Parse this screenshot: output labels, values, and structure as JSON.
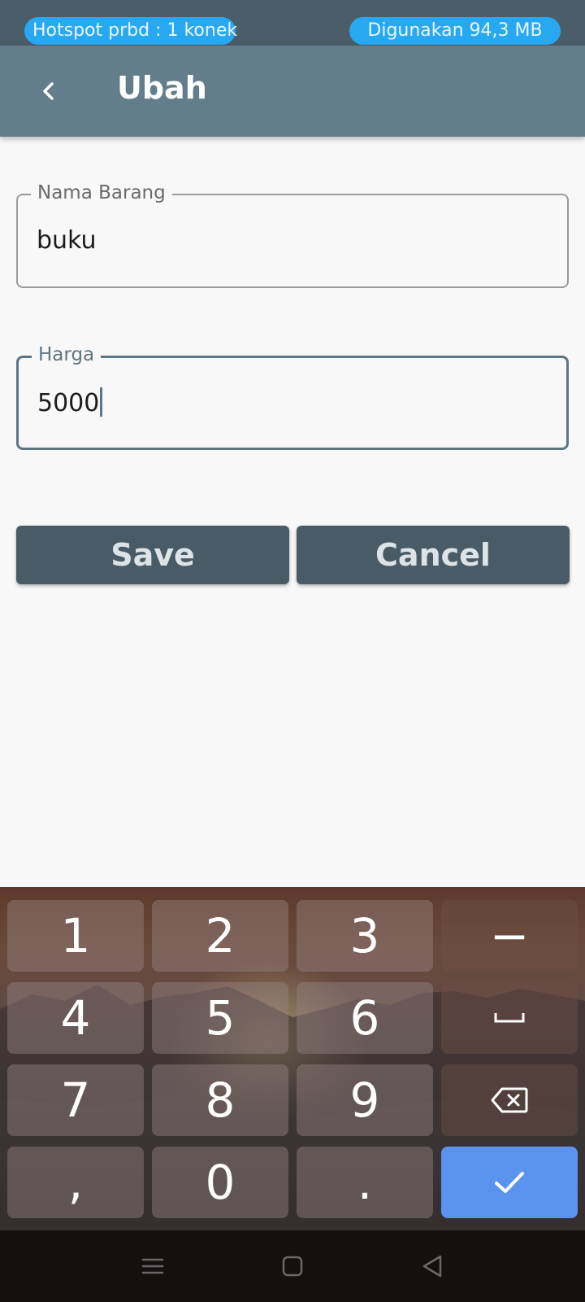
{
  "status_bar": {
    "hotspot": "Hotspot prbd : 1 konek",
    "data_usage": "Digunakan 94,3 MB"
  },
  "app_bar": {
    "back_icon": "chevron-left-icon",
    "title": "Ubah"
  },
  "form": {
    "name_field": {
      "label": "Nama Barang",
      "value": "buku"
    },
    "price_field": {
      "label": "Harga",
      "value": "5000"
    }
  },
  "buttons": {
    "save": "Save",
    "cancel": "Cancel"
  },
  "keyboard": {
    "keys": {
      "k1": "1",
      "k2": "2",
      "k3": "3",
      "minus": "−",
      "k4": "4",
      "k5": "5",
      "k6": "6",
      "k7": "7",
      "k8": "8",
      "k9": "9",
      "comma": ",",
      "k0": "0",
      "period": "."
    },
    "icons": [
      "space-icon",
      "backspace-icon",
      "check-icon"
    ]
  },
  "nav_bar": {
    "icons": [
      "menu-icon",
      "home-icon",
      "back-triangle-icon"
    ]
  },
  "colors": {
    "status_bar": "#4a5d68",
    "pill": "#29a8f2",
    "app_bar": "#637d8b",
    "button": "#485b66",
    "focused_border": "#5e7583",
    "enter_key": "#5a93ee"
  }
}
